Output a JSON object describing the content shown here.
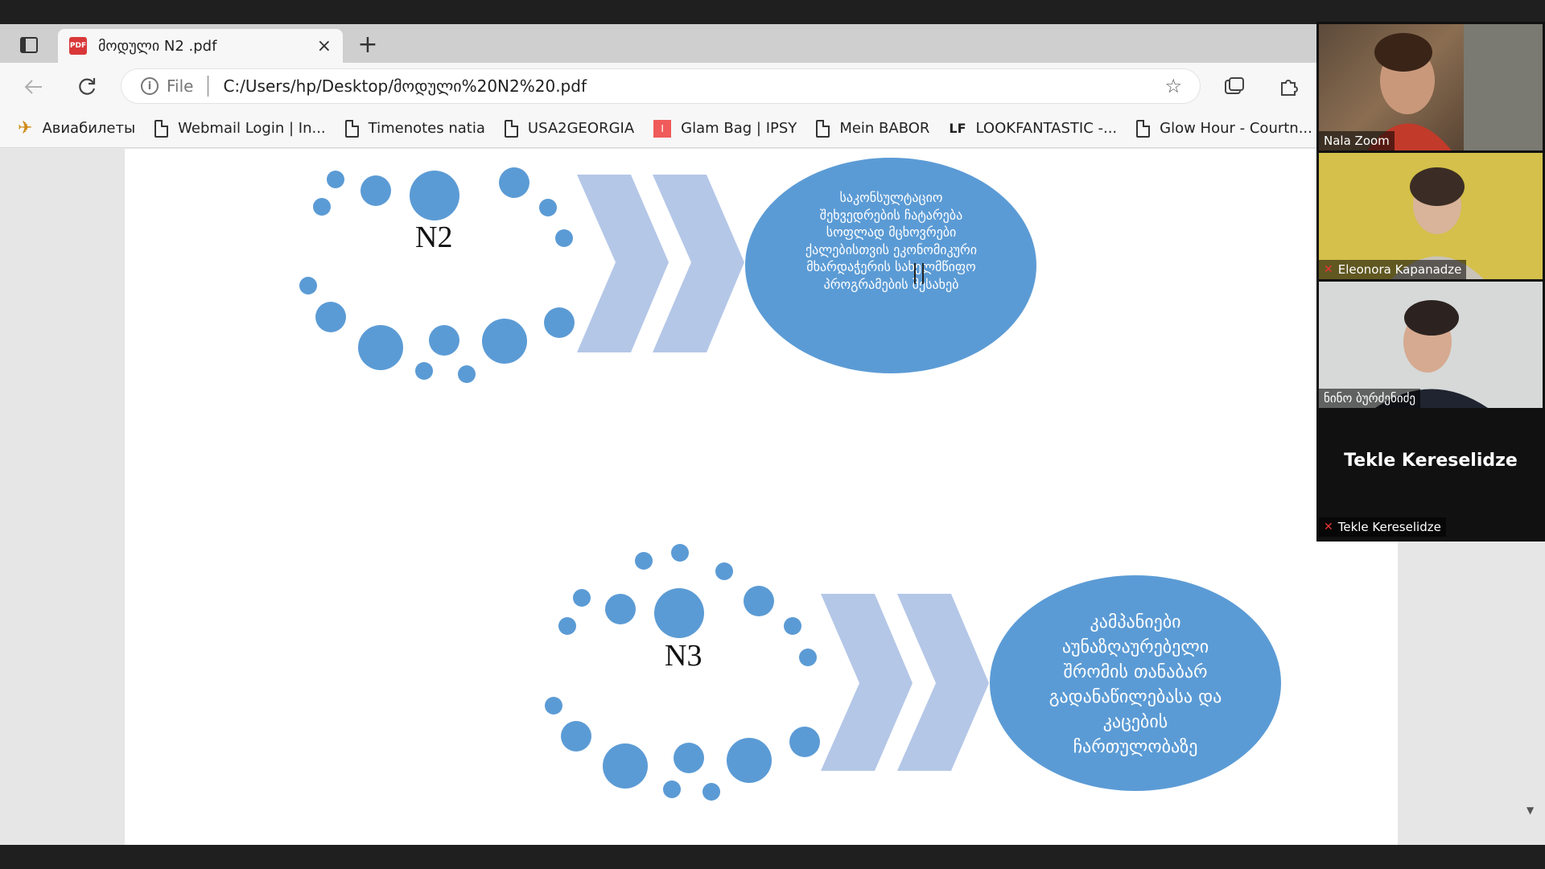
{
  "browser": {
    "tab_title": "მოდული N2 .pdf",
    "tab_close": "×",
    "new_tab": "+",
    "address_scheme": "File",
    "url": "C:/Users/hp/Desktop/მოდული%20N2%20.pdf",
    "bookmarks": [
      {
        "label": "Авиабилеты",
        "icon": "plane-icon"
      },
      {
        "label": "Webmail Login | In...",
        "icon": "page-icon"
      },
      {
        "label": "Timenotes natia",
        "icon": "page-icon"
      },
      {
        "label": "USA2GEORGIA",
        "icon": "page-icon"
      },
      {
        "label": "Glam Bag | IPSY",
        "icon": "ipsy-icon"
      },
      {
        "label": "Mein BABOR",
        "icon": "page-icon"
      },
      {
        "label": "LOOKFANTASTIC -...",
        "icon": "lf-icon"
      },
      {
        "label": "Glow Hour - Courtn...",
        "icon": "page-icon"
      }
    ],
    "lf_badge": "LF",
    "ipsy_badge": "I"
  },
  "pdf": {
    "section2": {
      "label": "N2",
      "text_lines": [
        "საკონსულტაციო",
        "შეხვედრების ჩატარება",
        "სოფლად მცხოვრები",
        "ქალებისთვის ეკონომიკური",
        "მხარდაჭერის სახელმწიფო",
        "პროგრამების შესახებ"
      ]
    },
    "section3": {
      "label": "N3",
      "text_lines": [
        "კამპანიები",
        "აუნაზღაურებელი",
        "შრომის თანაბარ",
        "გადანაწილებასა და",
        "კაცების",
        "ჩართულობაზე"
      ]
    },
    "colors": {
      "dot": "#5b9bd5",
      "chevron": "#b4c7e7",
      "ellipse": "#5b9bd5"
    }
  },
  "zoom": {
    "participants": [
      {
        "name": "Nala Zoom",
        "muted": false
      },
      {
        "name": "Eleonora Kapanadze",
        "muted": true
      },
      {
        "name": "ნინო ბურძენიძე",
        "muted": false
      },
      {
        "name": "Tekle Kereselidze",
        "muted": true
      }
    ],
    "active_name_display": "Tekle Kereselidze"
  }
}
